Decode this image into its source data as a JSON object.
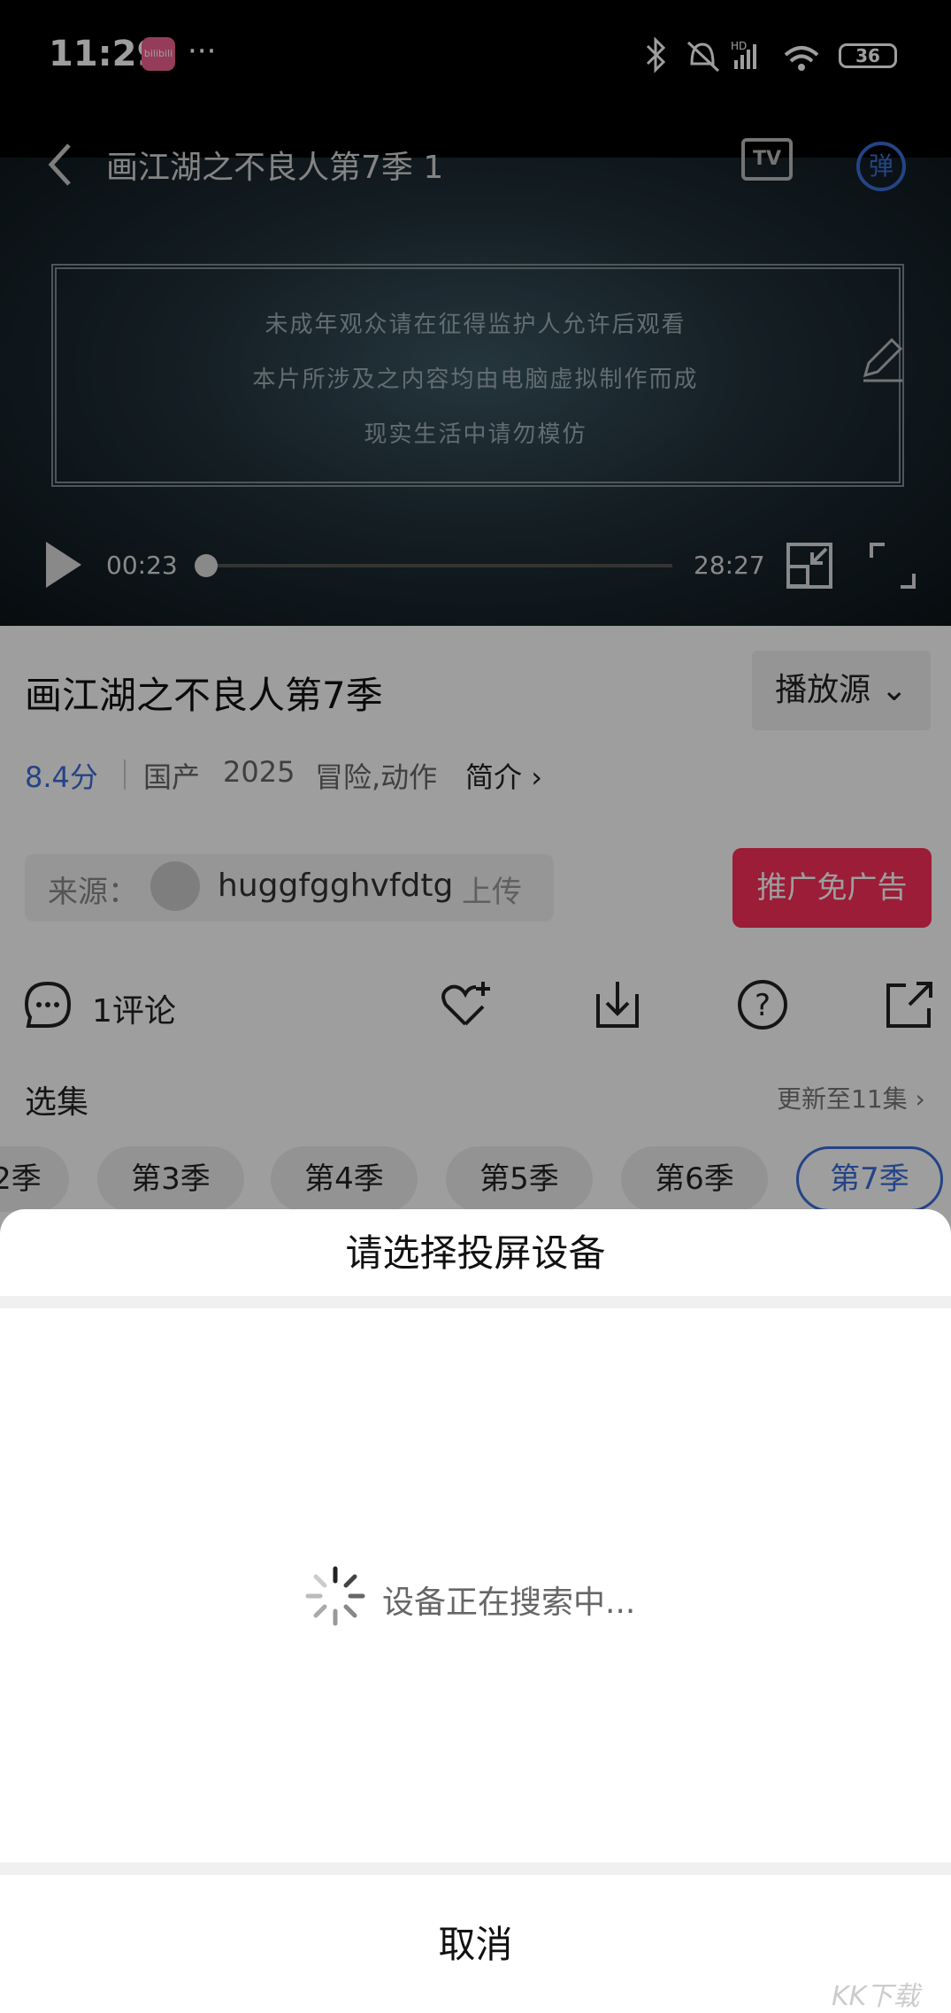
{
  "status_bar": {
    "time": "11:29",
    "app_icon_label": "bilibili",
    "more": "···",
    "battery": "36"
  },
  "player": {
    "title": "画江湖之不良人第7季 1",
    "tv_label": "TV",
    "danmaku_label": "弹",
    "warning_lines": [
      "未成年观众请在征得监护人允许后观看",
      "本片所涉及之内容均由电脑虚拟制作而成",
      "现实生活中请勿模仿"
    ],
    "current_time": "00:23",
    "duration": "28:27",
    "progress": 0.013
  },
  "show": {
    "title": "画江湖之不良人第7季",
    "source_button": "播放源",
    "score": "8.4分",
    "region": "国产",
    "year": "2025",
    "genres": "冒险,动作",
    "intro_label": "简介",
    "source_label": "来源：",
    "uploader": "huggfgghvfdtg",
    "uploaded_label": "上传",
    "promo_button": "推广免广告",
    "comments": "1评论"
  },
  "episodes": {
    "label": "选集",
    "update_info": "更新至11集",
    "seasons": [
      "2季",
      "第3季",
      "第4季",
      "第5季",
      "第6季",
      "第7季"
    ],
    "active": "第7季"
  },
  "cast_sheet": {
    "title": "请选择投屏设备",
    "status": "设备正在搜索中...",
    "cancel": "取消"
  },
  "watermark": "KK下载"
}
